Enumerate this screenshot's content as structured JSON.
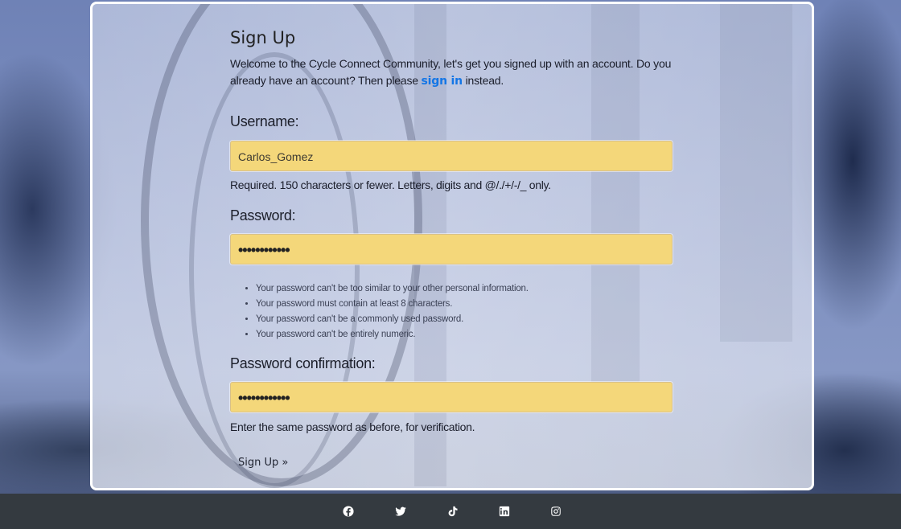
{
  "signup": {
    "title": "Sign Up",
    "intro_text": "Welcome to the Cycle Connect Community, let's get you signed up with an account. Do you already have an account? Then please",
    "signin_link": "sign in",
    "intro_suffix": "instead.",
    "username_label": "Username:",
    "username_value": "Carlos_Gomez",
    "username_help": "Required. 150 characters or fewer. Letters, digits and @/./+/-/_ only.",
    "password_label": "Password:",
    "password_value": "••••••••••••",
    "password_rules": [
      "Your password can't be too similar to your other personal information.",
      "Your password must contain at least 8 characters.",
      "Your password can't be a commonly used password.",
      "Your password can't be entirely numeric."
    ],
    "confirm_label": "Password confirmation:",
    "confirm_value": "••••••••••••",
    "confirm_help": "Enter the same password as before, for verification.",
    "submit_label": "Sign Up »"
  },
  "footer": {
    "social_icons": [
      "facebook-icon",
      "twitter-icon",
      "tiktok-icon",
      "linkedin-icon",
      "instagram-icon"
    ]
  },
  "colors": {
    "input_background": "#f4d77a",
    "link": "#1476e6",
    "footer_background": "#343a40"
  }
}
